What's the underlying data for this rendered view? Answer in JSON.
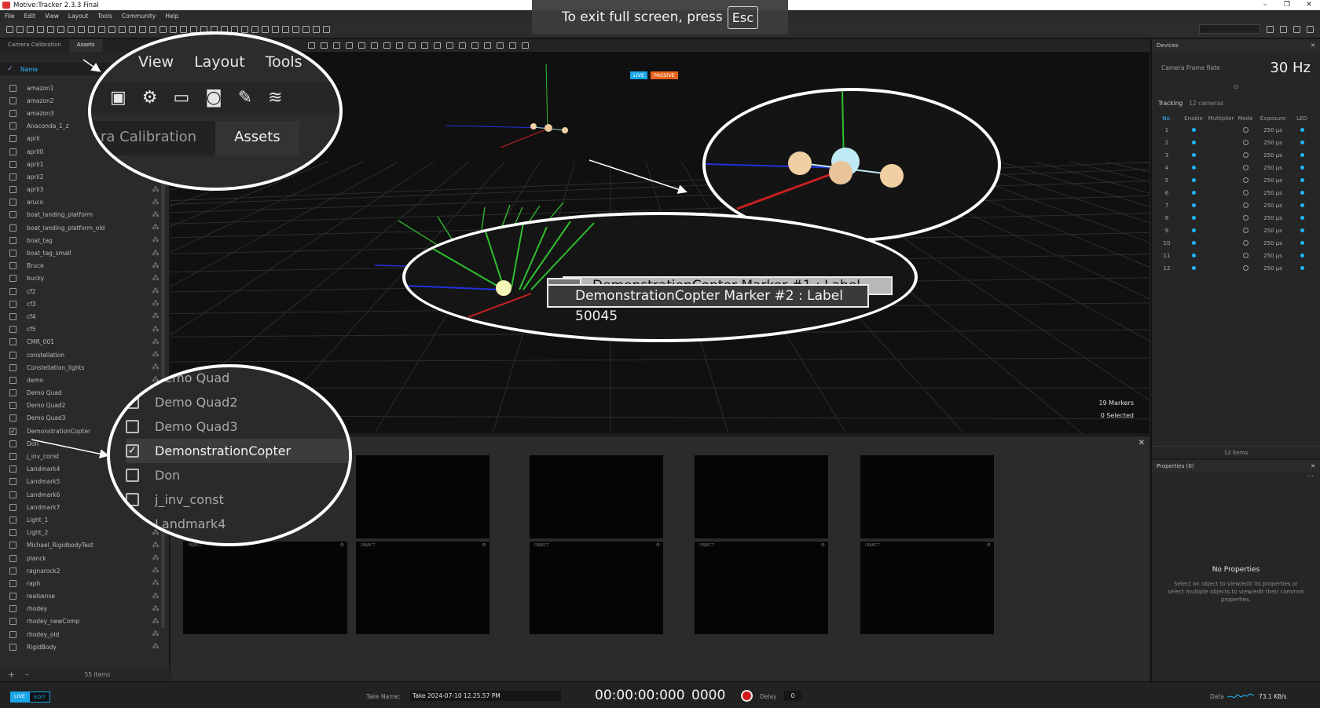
{
  "window": {
    "title": "Motive:Tracker 2.3.3 Final"
  },
  "menu": [
    "File",
    "Edit",
    "View",
    "Layout",
    "Tools",
    "Community",
    "Help"
  ],
  "fullscreen_toast": {
    "text": "To exit full screen, press",
    "key": "Esc"
  },
  "left_panel": {
    "tabs": [
      "Camera Calibration",
      "Assets"
    ],
    "active_tab": "Assets",
    "column_header": "Name",
    "assets": [
      {
        "name": "amazon1",
        "checked": false
      },
      {
        "name": "amazon2",
        "checked": false
      },
      {
        "name": "amazon3",
        "checked": false
      },
      {
        "name": "Anaconda_1_z",
        "checked": false
      },
      {
        "name": "april",
        "checked": false
      },
      {
        "name": "april0",
        "checked": false
      },
      {
        "name": "april1",
        "checked": false
      },
      {
        "name": "april2",
        "checked": false
      },
      {
        "name": "april3",
        "checked": false
      },
      {
        "name": "aruco",
        "checked": false
      },
      {
        "name": "boat_landing_platform",
        "checked": false
      },
      {
        "name": "boat_landing_platform_old",
        "checked": false
      },
      {
        "name": "boat_tag",
        "checked": false
      },
      {
        "name": "boat_tag_small",
        "checked": false
      },
      {
        "name": "Bruce",
        "checked": false
      },
      {
        "name": "bucky",
        "checked": false
      },
      {
        "name": "cf2",
        "checked": false
      },
      {
        "name": "cf3",
        "checked": false
      },
      {
        "name": "cf4",
        "checked": false
      },
      {
        "name": "cf5",
        "checked": false
      },
      {
        "name": "CMR_001",
        "checked": false
      },
      {
        "name": "constellation",
        "checked": false
      },
      {
        "name": "Constellation_lights",
        "checked": false
      },
      {
        "name": "demo",
        "checked": false
      },
      {
        "name": "Demo Quad",
        "checked": false
      },
      {
        "name": "Demo Quad2",
        "checked": false
      },
      {
        "name": "Demo Quad3",
        "checked": false
      },
      {
        "name": "DemonstrationCopter",
        "checked": true
      },
      {
        "name": "Don",
        "checked": false
      },
      {
        "name": "j_inv_const",
        "checked": false
      },
      {
        "name": "Landmark4",
        "checked": false
      },
      {
        "name": "Landmark5",
        "checked": false
      },
      {
        "name": "Landmark6",
        "checked": false
      },
      {
        "name": "Landmark7",
        "checked": false
      },
      {
        "name": "Light_1",
        "checked": false
      },
      {
        "name": "Light_2",
        "checked": false
      },
      {
        "name": "Michael_RigidbodyTest",
        "checked": false
      },
      {
        "name": "planck",
        "checked": false
      },
      {
        "name": "ragnarock2",
        "checked": false
      },
      {
        "name": "raph",
        "checked": false
      },
      {
        "name": "realsense",
        "checked": false
      },
      {
        "name": "rhodey",
        "checked": false
      },
      {
        "name": "rhodey_newComp",
        "checked": false
      },
      {
        "name": "rhodey_old",
        "checked": false
      },
      {
        "name": "RigidBody",
        "checked": false
      }
    ],
    "footer_add": "+",
    "footer_remove": "−",
    "footer_count": "55 items"
  },
  "callout_menu": {
    "items": [
      "View",
      "Layout",
      "Tools"
    ],
    "tabs": [
      "ra Calibration",
      "Assets"
    ]
  },
  "callout_label": {
    "back": "DemonstrationCopter Marker #1 : Label 50044",
    "front": "DemonstrationCopter Marker #2 : Label 50045"
  },
  "callout_list": [
    "Demo Quad",
    "Demo Quad2",
    "Demo Quad3",
    "DemonstrationCopter",
    "Don",
    "j_inv_const",
    "Landmark4"
  ],
  "callout_list_checked_index": 3,
  "viewport": {
    "badges": {
      "live": "LIVE",
      "passive": "PASSIVE"
    },
    "markers": "19 Markers",
    "selected": "0 Selected"
  },
  "camera_views": {
    "close": "✕",
    "bottom_labels": [
      "OBJECT",
      "OBJECT",
      "OBJECT",
      "OBJECT",
      "OBJECT"
    ]
  },
  "devices": {
    "title": "Devices",
    "frame_rate_label": "Camera Frame Rate",
    "frame_rate_value": "30 Hz",
    "tracking_label": "Tracking",
    "tracking_count": "12 cameras",
    "columns": [
      "No.",
      "Enable",
      "Multiplier",
      "Mode",
      "Exposure",
      "LED"
    ],
    "cameras": [
      {
        "no": "1",
        "exposure": "250 µs"
      },
      {
        "no": "2",
        "exposure": "250 µs"
      },
      {
        "no": "3",
        "exposure": "250 µs"
      },
      {
        "no": "4",
        "exposure": "250 µs"
      },
      {
        "no": "5",
        "exposure": "250 µs"
      },
      {
        "no": "6",
        "exposure": "250 µs"
      },
      {
        "no": "7",
        "exposure": "250 µs"
      },
      {
        "no": "8",
        "exposure": "250 µs"
      },
      {
        "no": "9",
        "exposure": "250 µs"
      },
      {
        "no": "10",
        "exposure": "250 µs"
      },
      {
        "no": "11",
        "exposure": "250 µs"
      },
      {
        "no": "12",
        "exposure": "250 µs"
      }
    ],
    "footer": "12 items"
  },
  "properties": {
    "title": "Properties (0)",
    "empty_title": "No Properties",
    "empty_desc": "Select an object to view/edit its properties or select multiple objects to view/edit their common properties."
  },
  "statusbar": {
    "live": "LIVE",
    "edit": "EDIT",
    "take_label": "Take Name:",
    "take_name": "Take 2024-07-10 12.25.57 PM",
    "timecode": "00:00:00:000",
    "frames": "0000",
    "delay_label": "Delay",
    "delay_value": "0",
    "data_label": "Data",
    "data_rate": "73.1 KB/s"
  },
  "colors": {
    "accent": "#1aa6e8",
    "passive": "#e8631a",
    "record": "#d31b1b"
  }
}
